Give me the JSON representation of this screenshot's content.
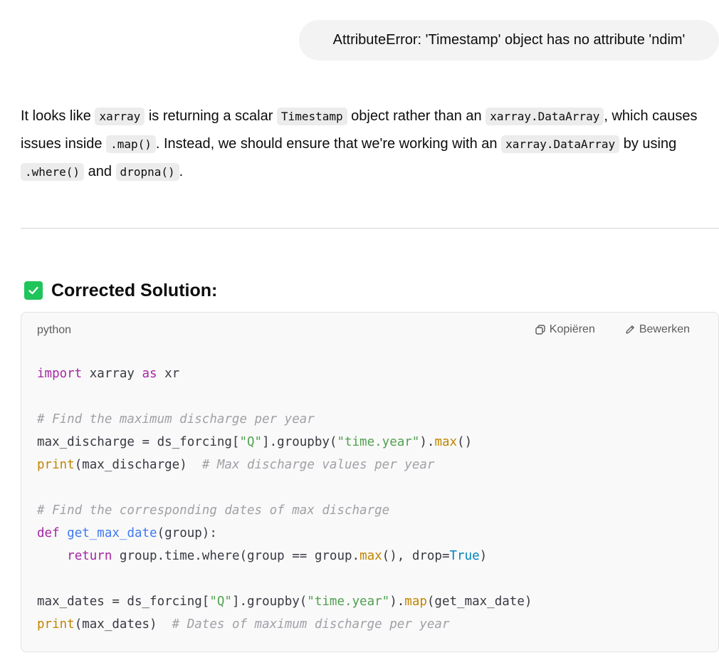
{
  "user_message": "AttributeError: 'Timestamp' object has no attribute 'ndim'",
  "answer": {
    "p1": "It looks like ",
    "c1": "xarray",
    "p2": " is returning a scalar ",
    "c2": "Timestamp",
    "p3": " object rather than an ",
    "c3": "xarray.DataArray",
    "p4": ", which causes issues inside ",
    "c4": ".map()",
    "p5": ". Instead, we should ensure that we're working with an ",
    "c5": "xarray.DataArray",
    "p6": " by using ",
    "c6": ".where()",
    "p7": " and ",
    "c7": "dropna()",
    "p8": "."
  },
  "section": {
    "icon": "check-icon",
    "title": "Corrected Solution:"
  },
  "code_block": {
    "language": "python",
    "copy_label": "Kopiëren",
    "edit_label": "Bewerken",
    "line1": {
      "kw": "import",
      "t1": " xarray ",
      "kw2": "as",
      "t2": " xr"
    },
    "line3": {
      "cm": "# Find the maximum discharge per year"
    },
    "line4": {
      "t1": "max_discharge = ds_forcing[",
      "s1": "\"Q\"",
      "t2": "].groupby(",
      "s2": "\"time.year\"",
      "t3": ").",
      "b1": "max",
      "t4": "()"
    },
    "line5": {
      "b1": "print",
      "t1": "(max_discharge)  ",
      "cm": "# Max discharge values per year"
    },
    "line7": {
      "cm": "# Find the corresponding dates of max discharge"
    },
    "line8": {
      "kw": "def",
      "t1": " ",
      "fn": "get_max_date",
      "t2": "(group):"
    },
    "line9": {
      "indent": "    ",
      "kw": "return",
      "t1": " group.time.where(group == group.",
      "b1": "max",
      "t2": "(), drop=",
      "cn": "True",
      "t3": ")"
    },
    "line11": {
      "t1": "max_dates = ds_forcing[",
      "s1": "\"Q\"",
      "t2": "].groupby(",
      "s2": "\"time.year\"",
      "t3": ").",
      "b1": "map",
      "t4": "(get_max_date)"
    },
    "line12": {
      "b1": "print",
      "t1": "(max_dates)  ",
      "cm": "# Dates of maximum discharge per year"
    }
  }
}
